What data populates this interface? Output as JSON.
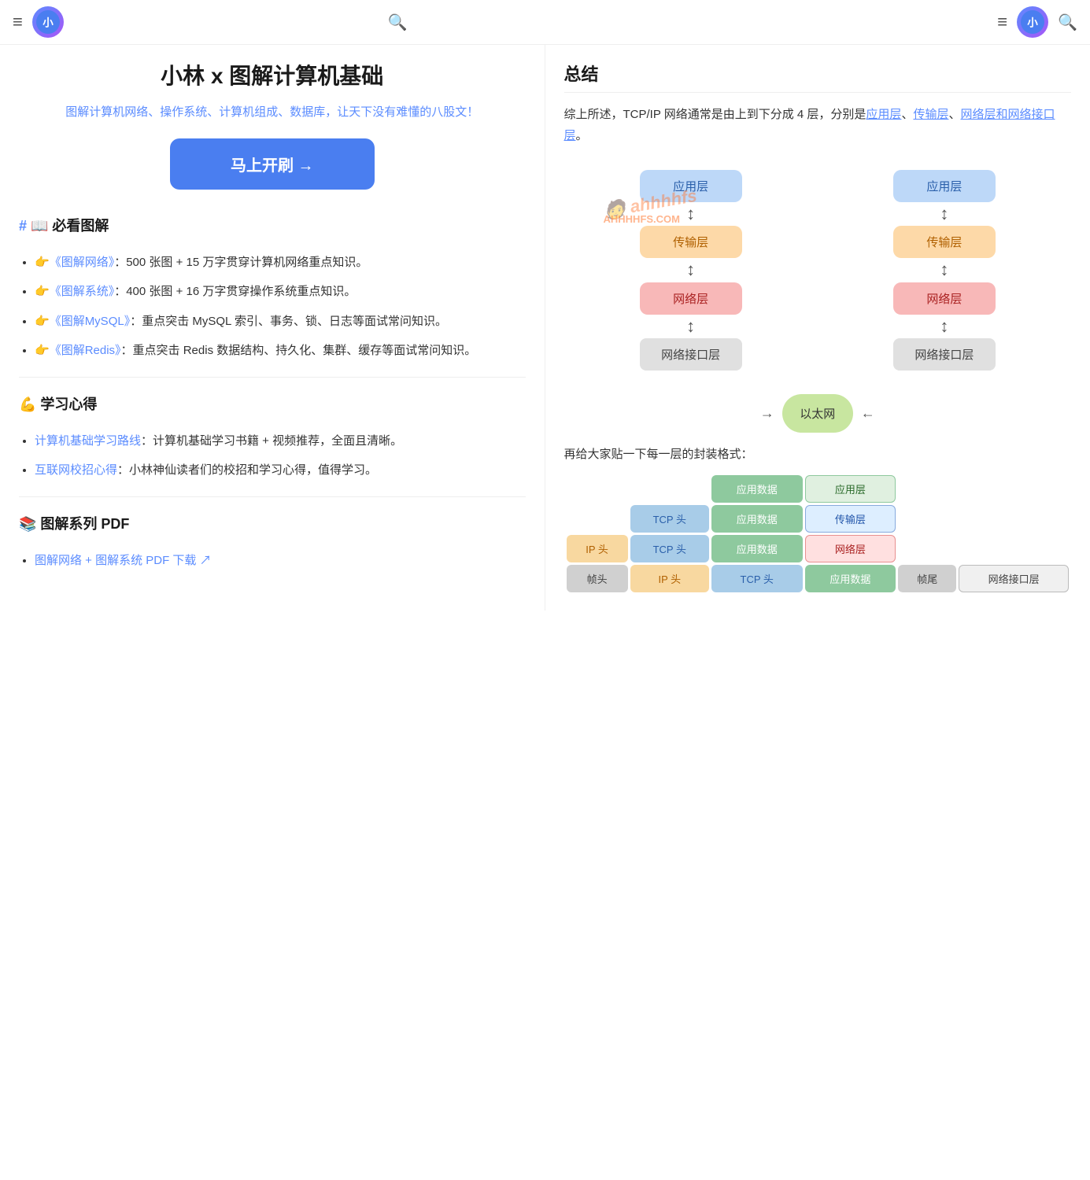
{
  "header": {
    "hamburger_left": "≡",
    "hamburger_right": "≡",
    "logo_text": "小",
    "search_icon": "🔍"
  },
  "left": {
    "site_title": "小林 x 图解计算机基础",
    "site_subtitle": "图解计算机网络、操作系统、计算机组成、数据库，让天下没有难懂的八股文！",
    "start_button": "马上开刷 →",
    "section1_title": "# 📖 必看图解",
    "items1": [
      "👉《图解网络》：500 张图 + 15 万字贯穿计算机网络重点知识。",
      "👉《图解系统》：400 张图 + 16 万字贯穿操作系统重点知识。",
      "👉《图解MySQL》：重点突击 MySQL 索引、事务、锁、日志等面试常问知识。",
      "👉《图解Redis》：重点突击 Redis 数据结构、持久化、集群、缓存等面试常问知识。"
    ],
    "items1_links": [
      "《图解网络》",
      "《图解系统》",
      "《图解MySQL》",
      "《图解Redis》"
    ],
    "section2_title": "💪 学习心得",
    "items2": [
      "计算机基础学习路线：计算机基础学习书籍 + 视频推荐，全面且清晰。",
      "互联网校招心得：小林神仙读者们的校招和学习心得，值得学习。"
    ],
    "items2_links": [
      "计算机基础学习路线",
      "互联网校招心得"
    ],
    "section3_title": "📚 图解系列 PDF",
    "items3": [
      "图解网络 + 图解系统 PDF 下载 ↗"
    ]
  },
  "right": {
    "summary_title": "总结",
    "summary_text": "综上所述，TCP/IP 网络通常是由上到下分成 4 层，分别是应用层、传输层、网络层和网络接口层。",
    "summary_links": [
      "应用层",
      "传输层",
      "网络层",
      "网络接口层"
    ],
    "net_left": {
      "boxes": [
        "应用层",
        "传输层",
        "网络层",
        "网络接口层"
      ],
      "colors": [
        "blue",
        "orange",
        "pink",
        "gray"
      ]
    },
    "net_right": {
      "boxes": [
        "应用层",
        "传输层",
        "网络层",
        "网络接口层"
      ],
      "colors": [
        "blue",
        "orange",
        "pink",
        "gray"
      ]
    },
    "ethernet_label": "以太网",
    "encap_title": "再给大家贴一下每一层的封装格式：",
    "encap_rows": [
      {
        "cells": [
          "应用数据",
          "应用层"
        ],
        "cell_styles": [
          "green-light",
          "green-border"
        ]
      },
      {
        "cells": [
          "TCP 头",
          "应用数据",
          "传输层"
        ],
        "cell_styles": [
          "blue-light",
          "green-light",
          "blue-border"
        ]
      },
      {
        "cells": [
          "IP 头",
          "TCP 头",
          "应用数据",
          "网络层"
        ],
        "cell_styles": [
          "orange-light",
          "blue-light",
          "green-light",
          "orange-border"
        ]
      },
      {
        "cells": [
          "帧头",
          "IP 头",
          "TCP 头",
          "应用数据",
          "帧尾",
          "网络接口层"
        ],
        "cell_styles": [
          "gray",
          "orange-light",
          "blue-light",
          "green-light",
          "gray",
          "gray-border"
        ]
      }
    ]
  }
}
